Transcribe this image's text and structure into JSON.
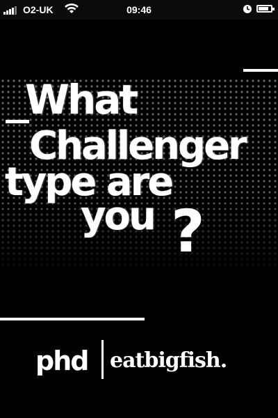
{
  "status_bar": {
    "carrier": "O2-UK",
    "time": "09:46",
    "battery_level": 0.85,
    "icons": [
      "signal-bars-icon",
      "wifi-icon",
      "clock-icon",
      "battery-icon"
    ]
  },
  "headline": {
    "lines": [
      "What",
      "Challenger",
      "type are",
      "you"
    ],
    "question_mark": "?"
  },
  "branding": {
    "left": "phd",
    "right": "eatbigfish."
  },
  "colors": {
    "background": "#000000",
    "text": "#ffffff",
    "dots": "#5e5e5e"
  }
}
